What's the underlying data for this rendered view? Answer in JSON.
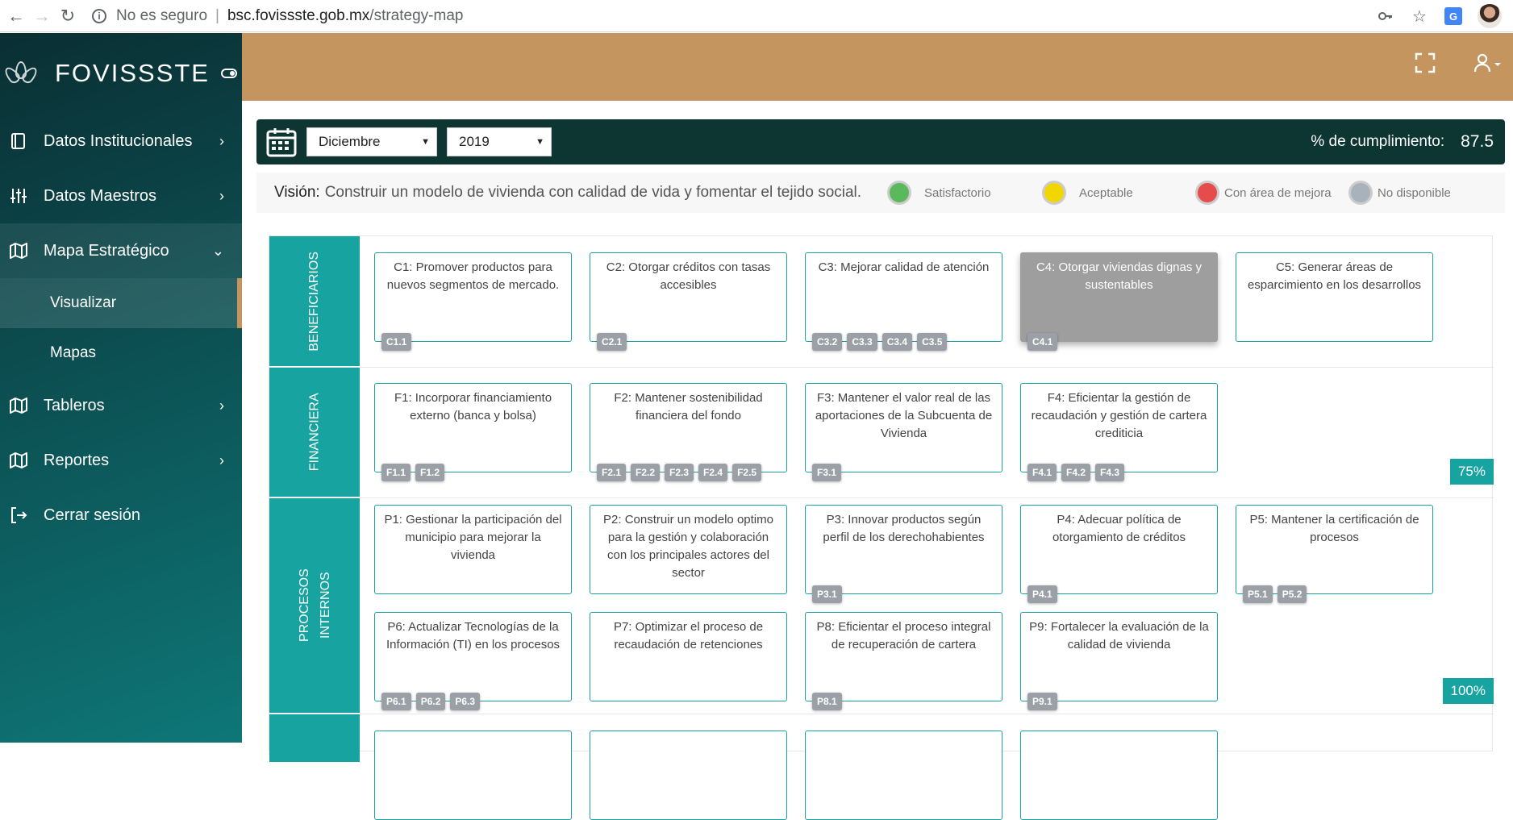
{
  "browser": {
    "not_secure": "No es seguro",
    "url_host": "bsc.fovissste.gob.mx",
    "url_path": "/strategy-map"
  },
  "brand": {
    "name": "FOVISSSTE"
  },
  "sidebar": {
    "items": [
      {
        "label": "Datos Institucionales",
        "icon": "book-icon",
        "arrow": "›"
      },
      {
        "label": "Datos Maestros",
        "icon": "sliders-icon",
        "arrow": "›"
      },
      {
        "label": "Mapa Estratégico",
        "icon": "map-icon",
        "arrow": "⌄"
      },
      {
        "label": "Tableros",
        "icon": "map-icon",
        "arrow": "›"
      },
      {
        "label": "Reportes",
        "icon": "map-icon",
        "arrow": "›"
      },
      {
        "label": "Cerrar sesión",
        "icon": "logout-icon"
      }
    ],
    "sub_items": [
      {
        "label": "Visualizar"
      },
      {
        "label": "Mapas"
      }
    ]
  },
  "filters": {
    "month": "Diciembre",
    "year": "2019",
    "cumplimiento_label": "% de cumplimiento:",
    "cumplimiento_value": "87.5"
  },
  "vision": {
    "label": "Visión:",
    "text": "Construir un modelo de vivienda con calidad de vida y fomentar el tejido social."
  },
  "legend": [
    {
      "label": "Satisfactorio",
      "color": "#5cb85c"
    },
    {
      "label": "Aceptable",
      "color": "#f2d600"
    },
    {
      "label": "Con área de mejora",
      "color": "#e74c4c"
    },
    {
      "label": "No disponible",
      "color": "#a8b2bd"
    }
  ],
  "rows": {
    "beneficiarios": {
      "label": "BENEFICIARIOS",
      "cards": [
        {
          "text": "C1: Promover productos para nuevos segmentos de mercado.",
          "chips": [
            "C1.1"
          ]
        },
        {
          "text": "C2: Otorgar créditos con tasas accesibles",
          "chips": [
            "C2.1"
          ]
        },
        {
          "text": "C3: Mejorar calidad de atención",
          "chips": [
            "C3.2",
            "C3.3",
            "C3.4",
            "C3.5"
          ]
        },
        {
          "text": "C4: Otorgar viviendas dignas y sustentables",
          "chips": [
            "C4.1"
          ]
        },
        {
          "text": "C5: Generar áreas de esparcimiento en los desarrollos",
          "chips": []
        }
      ]
    },
    "financiera": {
      "label": "FINANCIERA",
      "percent": "75%",
      "cards": [
        {
          "text": "F1: Incorporar financiamiento externo (banca y bolsa)",
          "chips": [
            "F1.1",
            "F1.2"
          ]
        },
        {
          "text": "F2: Mantener sostenibilidad financiera del fondo",
          "chips": [
            "F2.1",
            "F2.2",
            "F2.3",
            "F2.4",
            "F2.5"
          ]
        },
        {
          "text": "F3: Mantener el valor real de las aportaciones de la Subcuenta de Vivienda",
          "chips": [
            "F3.1"
          ]
        },
        {
          "text": "F4: Eficientar la gestión de recaudación y gestión de cartera crediticia",
          "chips": [
            "F4.1",
            "F4.2",
            "F4.3"
          ]
        }
      ]
    },
    "procesos": {
      "label_line1": "PROCESOS",
      "label_line2": "INTERNOS",
      "percent": "100%",
      "cards": [
        {
          "text": "P1: Gestionar la participación del municipio para mejorar la vivienda",
          "chips": []
        },
        {
          "text": "P2: Construir un modelo optimo para la gestión y colaboración con los principales actores del sector",
          "chips": []
        },
        {
          "text": "P3: Innovar productos según perfil de los derechohabientes",
          "chips": [
            "P3.1"
          ]
        },
        {
          "text": "P4: Adecuar política de otorgamiento de créditos",
          "chips": [
            "P4.1"
          ]
        },
        {
          "text": "P5: Mantener la certificación de procesos",
          "chips": [
            "P5.1",
            "P5.2"
          ]
        },
        {
          "text": "P6: Actualizar Tecnologías de la Información (TI) en los procesos",
          "chips": [
            "P6.1",
            "P6.2",
            "P6.3"
          ]
        },
        {
          "text": "P7: Optimizar el proceso de recaudación de retenciones",
          "chips": []
        },
        {
          "text": "P8: Eficientar el proceso integral de recuperación de cartera",
          "chips": [
            "P8.1"
          ]
        },
        {
          "text": "P9: Fortalecer la evaluación de la calidad de vivienda",
          "chips": [
            "P9.1"
          ]
        }
      ]
    }
  }
}
